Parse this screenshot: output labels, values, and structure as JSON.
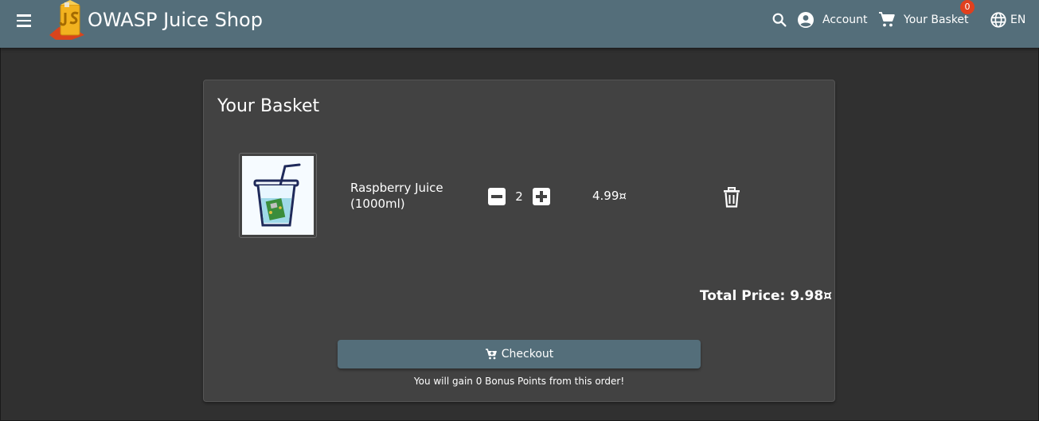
{
  "header": {
    "title": "OWASP Juice Shop",
    "account_label": "Account",
    "basket_label": "Your Basket",
    "basket_count": "0",
    "language_label": "EN"
  },
  "basket": {
    "title": "Your Basket",
    "items": [
      {
        "name": "Raspberry Juice (1000ml)",
        "quantity": "2",
        "price": "4.99¤"
      }
    ],
    "total_label": "Total Price: 9.98¤",
    "checkout_label": "Checkout",
    "bonus_text": "You will gain 0 Bonus Points from this order!"
  },
  "colors": {
    "toolbar": "#546e7a",
    "background": "#303030",
    "card": "#424242",
    "badge": "#e0401e"
  }
}
